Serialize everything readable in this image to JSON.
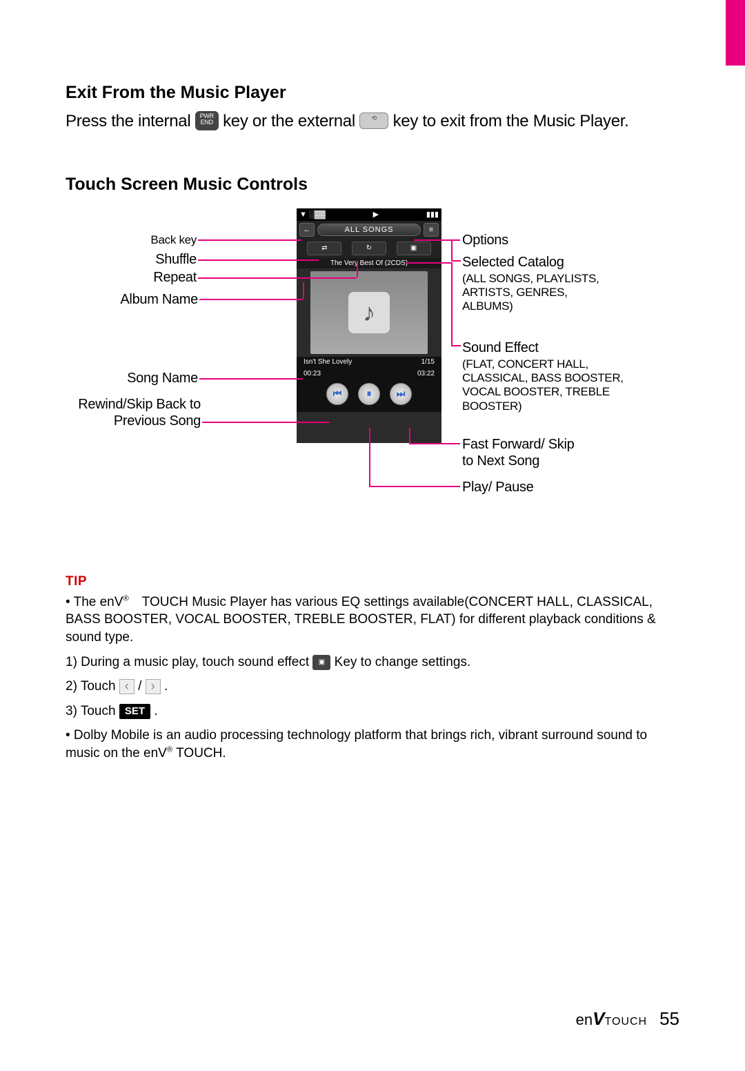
{
  "accent_color": "#e6007e",
  "section1": {
    "title": "Exit From the Music Player",
    "text_a": "Press the internal ",
    "key1": "PWR END",
    "text_b": " key or the external ",
    "key2": "⟲",
    "text_c": " key to exit from the Music Player."
  },
  "section2": {
    "title": "Touch Screen Music Controls"
  },
  "phone": {
    "status_left": "▼ ░▓▓",
    "status_mid": "▶",
    "status_right": "▮▮▮",
    "back_arrow": "←",
    "catalog_label": "ALL SONGS",
    "options_glyph": "≡",
    "shuffle_glyph": "⇄",
    "repeat_glyph": "↻",
    "sound_glyph": "▣",
    "album_name": "The Very Best Of (2CDS)",
    "song_name": "Isn't She Lovely",
    "track_index": "1/15",
    "time_elapsed": "00:23",
    "time_total": "03:22",
    "prev_glyph": "⏮",
    "play_glyph": "⏸",
    "next_glyph": "⏭"
  },
  "labels": {
    "back_key": "Back key",
    "shuffle": "Shuffle",
    "repeat": "Repeat",
    "album_name": "Album Name",
    "song_name": "Song Name",
    "rewind": "Rewind/Skip Back to Previous Song",
    "options": "Options",
    "selected_catalog": "Selected Catalog",
    "selected_catalog_sub": "(ALL SONGS, PLAYLISTS, ARTISTS, GENRES, ALBUMS)",
    "sound_effect": "Sound Effect",
    "sound_effect_sub": "(FLAT, CONCERT HALL, CLASSICAL, BASS BOOSTER, VOCAL BOOSTER, TREBLE BOOSTER)",
    "fast_forward": "Fast Forward/ Skip to Next Song",
    "play_pause": "Play/ Pause"
  },
  "tip": {
    "heading": "TIP",
    "bullet1_a": "• The enV",
    "bullet1_b": " TOUCH Music Player has various EQ settings available(CONCERT HALL, CLASSICAL, BASS BOOSTER, VOCAL BOOSTER, TREBLE BOOSTER, FLAT) for different playback conditions & sound type.",
    "step1_a": "1) During a music play, touch sound effect ",
    "step1_b": " Key to change settings.",
    "sound_key_glyph": "▣",
    "step2_a": "2) Touch ",
    "step2_slash": " / ",
    "step2_dot": " .",
    "lt": "‹",
    "gt": "›",
    "step3_a": "3) Touch ",
    "step3_dot": " .",
    "set_label": "SET",
    "bullet2_a": "• Dolby Mobile is an audio processing technology platform that brings rich, vibrant surround sound to music on the enV",
    "bullet2_b": " TOUCH.",
    "reg": "®"
  },
  "footer": {
    "brand_a": "en",
    "brand_b": "V",
    "brand_c": "TOUCH",
    "page": "55"
  }
}
